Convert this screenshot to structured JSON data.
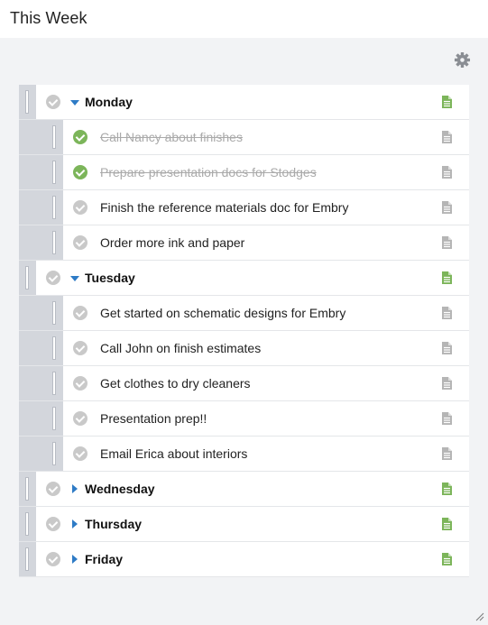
{
  "window": {
    "title": "This Week"
  },
  "colors": {
    "accent": "#2e7bc6",
    "done": "#7cb55a",
    "note_active": "#7cb55a",
    "note_inactive": "#b5b5b5"
  },
  "days": [
    {
      "label": "Monday",
      "expanded": true,
      "tasks": [
        {
          "label": "Call Nancy about finishes",
          "done": true
        },
        {
          "label": "Prepare presentation docs for Stodges",
          "done": true
        },
        {
          "label": "Finish the reference materials doc for Embry",
          "done": false
        },
        {
          "label": "Order more ink and paper",
          "done": false
        }
      ]
    },
    {
      "label": "Tuesday",
      "expanded": true,
      "tasks": [
        {
          "label": "Get started on schematic designs for Embry",
          "done": false
        },
        {
          "label": "Call John on finish estimates",
          "done": false
        },
        {
          "label": "Get clothes to dry cleaners",
          "done": false
        },
        {
          "label": "Presentation prep!!",
          "done": false
        },
        {
          "label": "Email Erica about interiors",
          "done": false
        }
      ]
    },
    {
      "label": "Wednesday",
      "expanded": false,
      "tasks": []
    },
    {
      "label": "Thursday",
      "expanded": false,
      "tasks": []
    },
    {
      "label": "Friday",
      "expanded": false,
      "tasks": []
    }
  ]
}
